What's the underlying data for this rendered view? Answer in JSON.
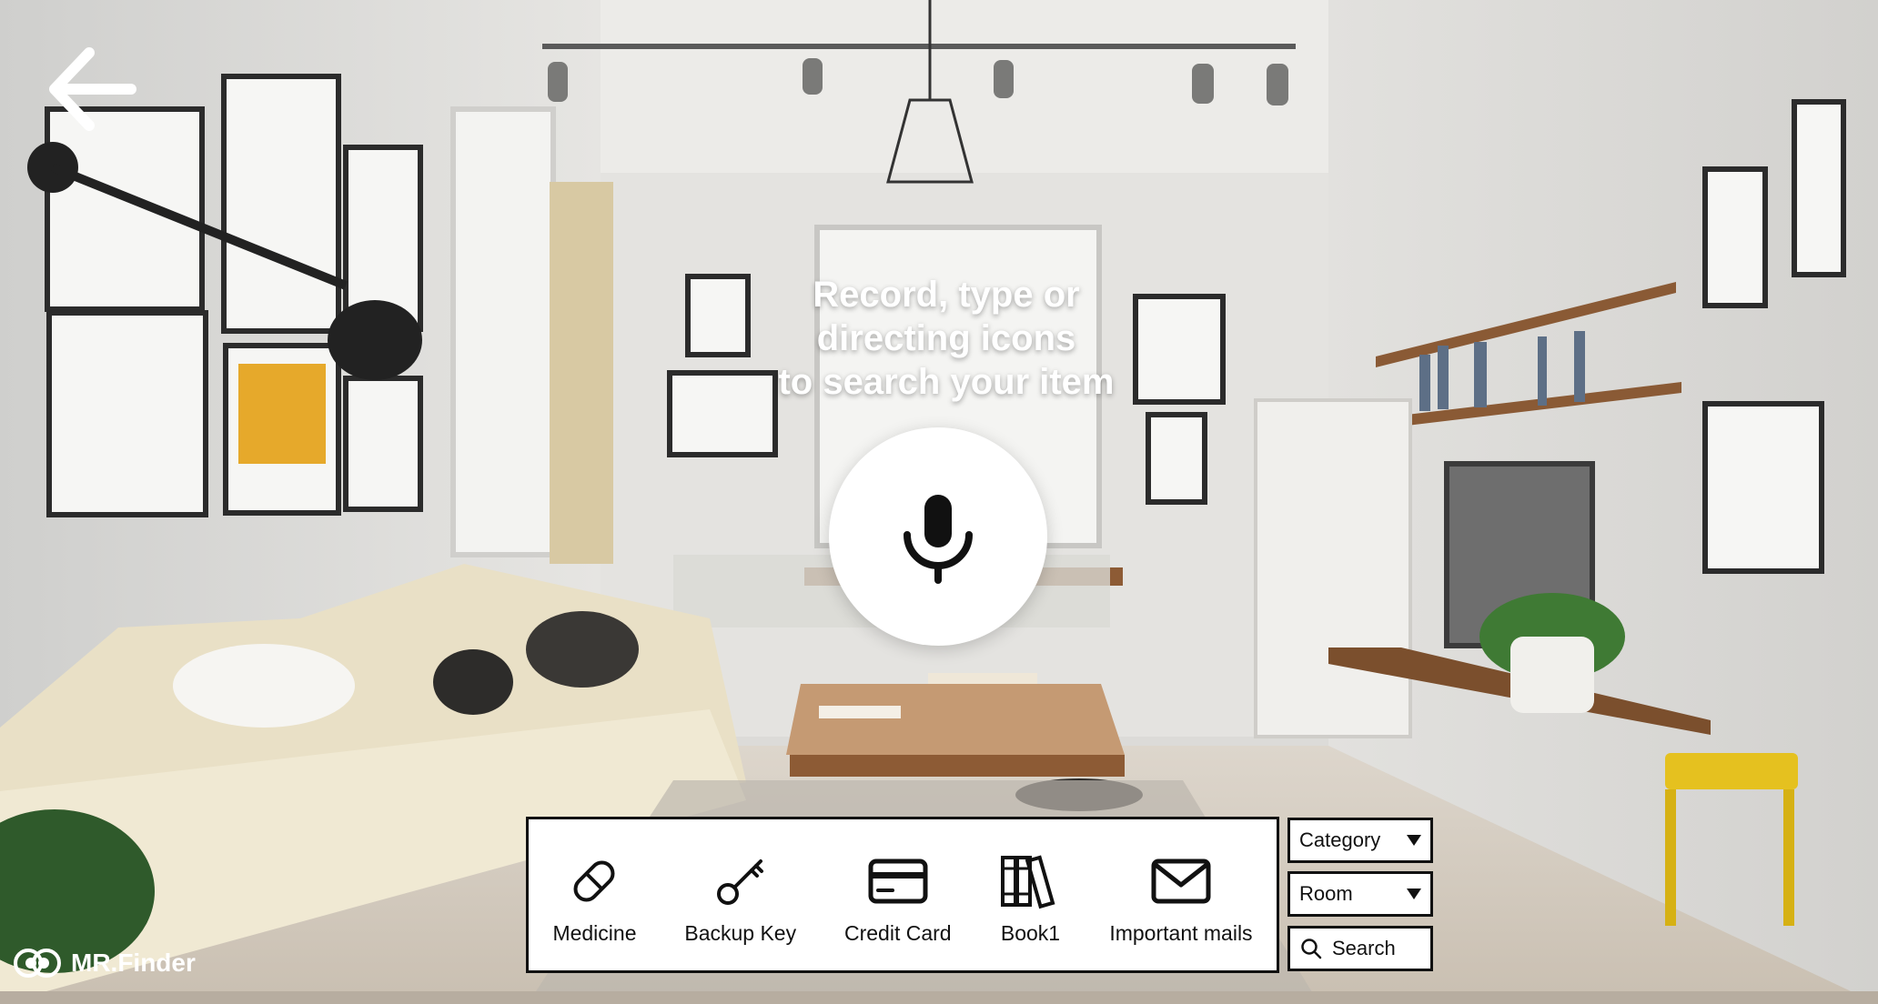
{
  "navigation": {
    "back_icon": "arrow-left-icon"
  },
  "prompt": {
    "lines": [
      "Record, type or",
      "directing icons",
      "to search your item"
    ]
  },
  "voice": {
    "icon": "microphone-icon"
  },
  "quick_items": [
    {
      "label": "Medicine",
      "icon": "pill-icon"
    },
    {
      "label": "Backup Key",
      "icon": "key-icon"
    },
    {
      "label": "Credit Card",
      "icon": "credit-card-icon"
    },
    {
      "label": "Book1",
      "icon": "books-icon"
    },
    {
      "label": "Important mails",
      "icon": "envelope-icon"
    }
  ],
  "filters": {
    "category": {
      "selected": "Category"
    },
    "room": {
      "selected": "Room"
    }
  },
  "search": {
    "label": "Search",
    "icon": "search-icon"
  },
  "brand": {
    "name": "MR.Finder",
    "logo_icon": "eyes-logo-icon"
  },
  "colors": {
    "panel_border": "#111111",
    "panel_bg": "#ffffff",
    "text_overlay": "#ffffff"
  }
}
